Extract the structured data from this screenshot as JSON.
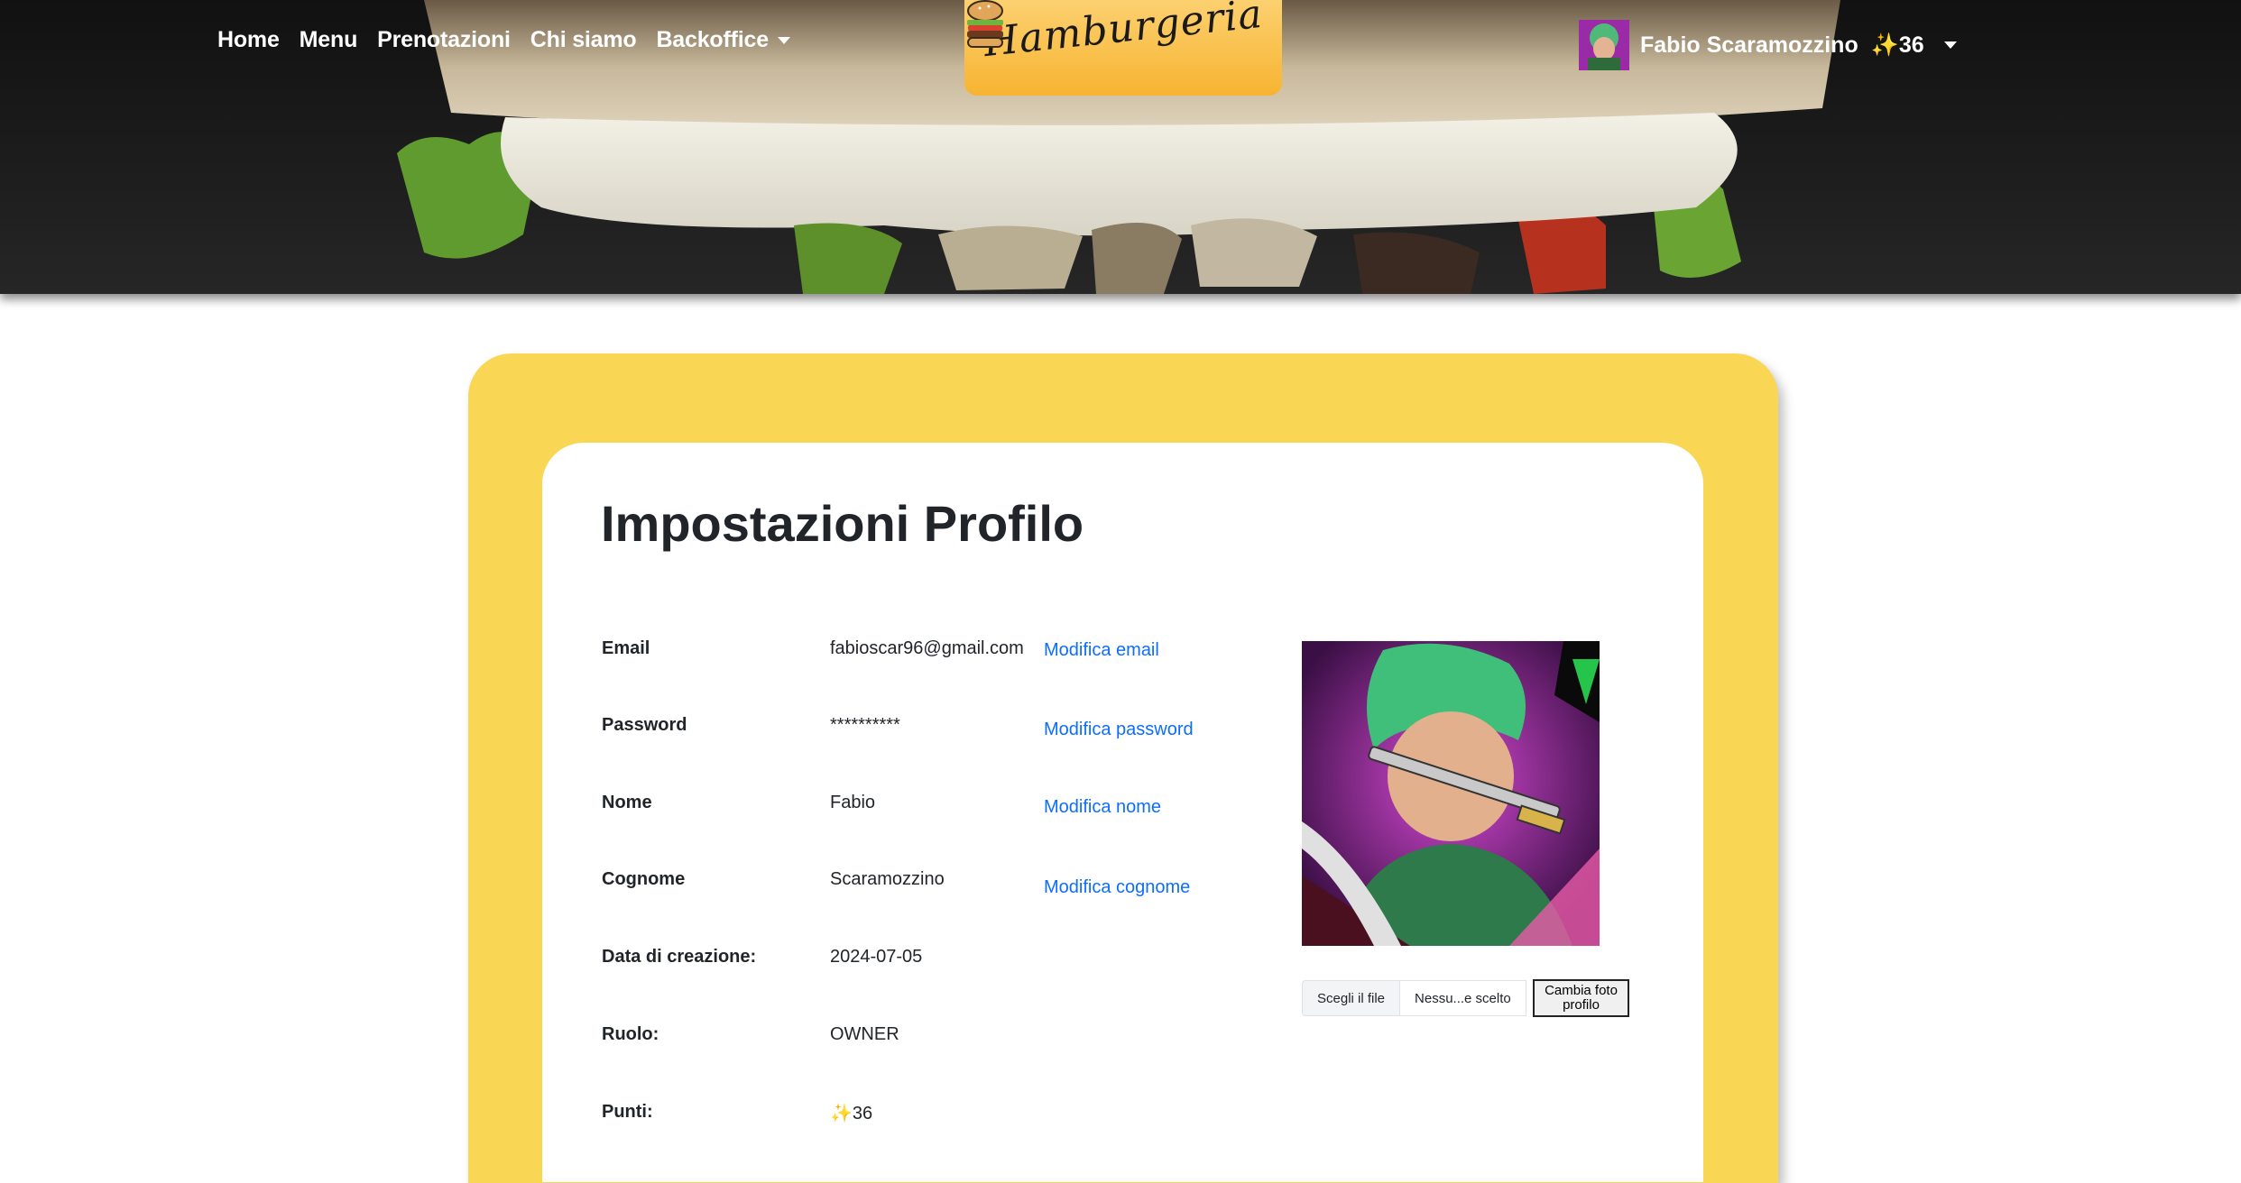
{
  "nav": {
    "items": [
      {
        "label": "Home"
      },
      {
        "label": "Menu"
      },
      {
        "label": "Prenotazioni"
      },
      {
        "label": "Chi siamo"
      },
      {
        "label": "Backoffice"
      }
    ]
  },
  "logo": {
    "text": "Hamburgeria",
    "icon": "burger-icon"
  },
  "user": {
    "name": "Fabio Scaramozzino",
    "points": "✨36",
    "avatar_icon": "avatar-icon"
  },
  "profile": {
    "title": "Impostazioni Profilo",
    "rows": [
      {
        "label": "Email",
        "value": "fabioscar96@gmail.com",
        "action": "Modifica email"
      },
      {
        "label": "Password",
        "value": "**********",
        "action": "Modifica password"
      },
      {
        "label": "Nome",
        "value": "Fabio",
        "action": "Modifica nome"
      },
      {
        "label": "Cognome",
        "value": "Scaramozzino",
        "action": "Modifica cognome"
      },
      {
        "label": "Data di creazione:",
        "value": "2024-07-05"
      },
      {
        "label": "Ruolo:",
        "value": "OWNER"
      },
      {
        "label": "Punti:",
        "value": "✨36"
      }
    ],
    "file_input": {
      "choose_label": "Scegli il file",
      "file_name": "Nessu...e scelto"
    },
    "upload_label": "Cambia foto profilo"
  },
  "colors": {
    "card_outer": "#f9d755",
    "logo_box": "#f7b431",
    "link": "#0d6efd",
    "header_bg": "#1b1b1b"
  }
}
